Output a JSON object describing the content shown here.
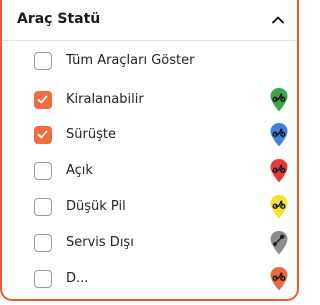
{
  "panel": {
    "title": "Araç Statü",
    "expanded": true
  },
  "filters": [
    {
      "label": "Tüm Araçları Göster",
      "checked": false,
      "pin_color": null,
      "pin_icon": null
    },
    {
      "label": "Kiralanabilir",
      "checked": true,
      "pin_color": "#3aa64a",
      "pin_icon": "scooter-icon"
    },
    {
      "label": "Sürüşte",
      "checked": true,
      "pin_color": "#3f7fe0",
      "pin_icon": "scooter-icon"
    },
    {
      "label": "Açık",
      "checked": false,
      "pin_color": "#e53935",
      "pin_icon": "scooter-icon"
    },
    {
      "label": "Düşük Pil",
      "checked": false,
      "pin_color": "#f5e22a",
      "pin_icon": "scooter-icon"
    },
    {
      "label": "Servis Dışı",
      "checked": false,
      "pin_color": "#8c8c8c",
      "pin_icon": "wrench-icon"
    },
    {
      "label": "D...",
      "checked": false,
      "pin_color": "#e86a3c",
      "pin_icon": "scooter-icon"
    }
  ],
  "colors": {
    "accent": "#f26d3d",
    "border": "#ef5a2f"
  }
}
